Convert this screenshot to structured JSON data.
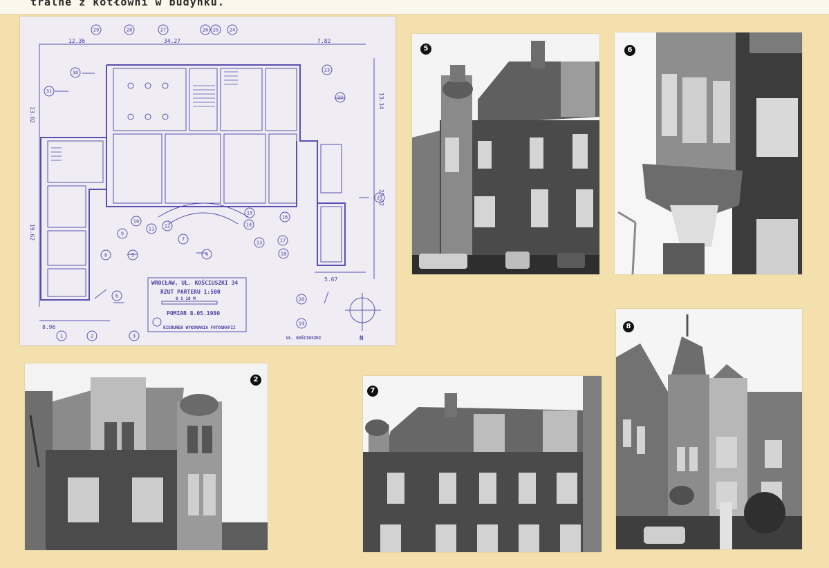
{
  "header": {
    "typed_line": "tralne z kotłowni w budynku."
  },
  "plan": {
    "title_line1": "WROCŁAW, UL. KOŚCIUSZKI 34",
    "title_line2": "RZUT PARTERU 1:500",
    "scale_label": "0 5 10 M",
    "date_label": "POMIAR 8.05.1980",
    "legend_label": "KIERUNEK WYKONANIA FOTOGRAFII",
    "street_bottom": "UL. KOŚCIUSZKI",
    "north": "N",
    "dims": {
      "top_left": "12.36",
      "top_mid": "34.27",
      "top_right": "7.82",
      "left": "13.02",
      "right_top": "13.14",
      "right_bottom": "23.22",
      "left_bottom": "19.62",
      "bottom_left": "8.96",
      "bottom_right": "5.67"
    },
    "markers": [
      "1",
      "2",
      "3",
      "4",
      "5",
      "6",
      "7",
      "8",
      "9",
      "10",
      "11",
      "12",
      "13",
      "14",
      "15",
      "16",
      "17",
      "18",
      "19",
      "20",
      "21",
      "22",
      "23",
      "24",
      "25",
      "26",
      "27",
      "28",
      "29",
      "30",
      "31"
    ]
  },
  "photos": {
    "p5": {
      "label": "5"
    },
    "p6": {
      "label": "6"
    },
    "p2": {
      "label": "2"
    },
    "p7": {
      "label": "7"
    },
    "p8": {
      "label": "8"
    }
  }
}
